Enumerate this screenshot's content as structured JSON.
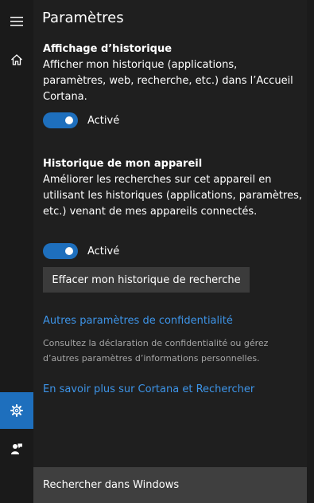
{
  "header": {
    "title": "Paramètres"
  },
  "rail": {
    "items": [
      {
        "icon": "hamburger-menu-icon"
      },
      {
        "icon": "home-icon"
      },
      {
        "icon": "gear-icon",
        "active": true
      },
      {
        "icon": "feedback-icon"
      }
    ],
    "accent": "#1e6fbd"
  },
  "sections": [
    {
      "heading": "Affichage d’historique",
      "description": "Afficher mon historique (applications, paramètres, web, recherche, etc.) dans l’Accueil Cortana.",
      "toggle_state": "Activé"
    },
    {
      "heading": "Historique de mon appareil",
      "description": "Améliorer les recherches sur cet appareil en utilisant les historiques (applications, paramètres, etc.) venant de mes appareils connectés.",
      "toggle_state": "Activé"
    }
  ],
  "actions": {
    "clear_history": "Effacer mon historique de recherche"
  },
  "links": {
    "privacy": "Autres paramètres de confidentialité",
    "privacy_note": "Consultez la déclaration de confidentialité ou gérez d’autres paramètres d’informations personnelles.",
    "learn_more": "En savoir plus sur Cortana et Rechercher"
  },
  "search": {
    "placeholder": "Rechercher dans Windows"
  },
  "colors": {
    "link": "#3d94e8",
    "toggle_on": "#1e6fbd"
  }
}
